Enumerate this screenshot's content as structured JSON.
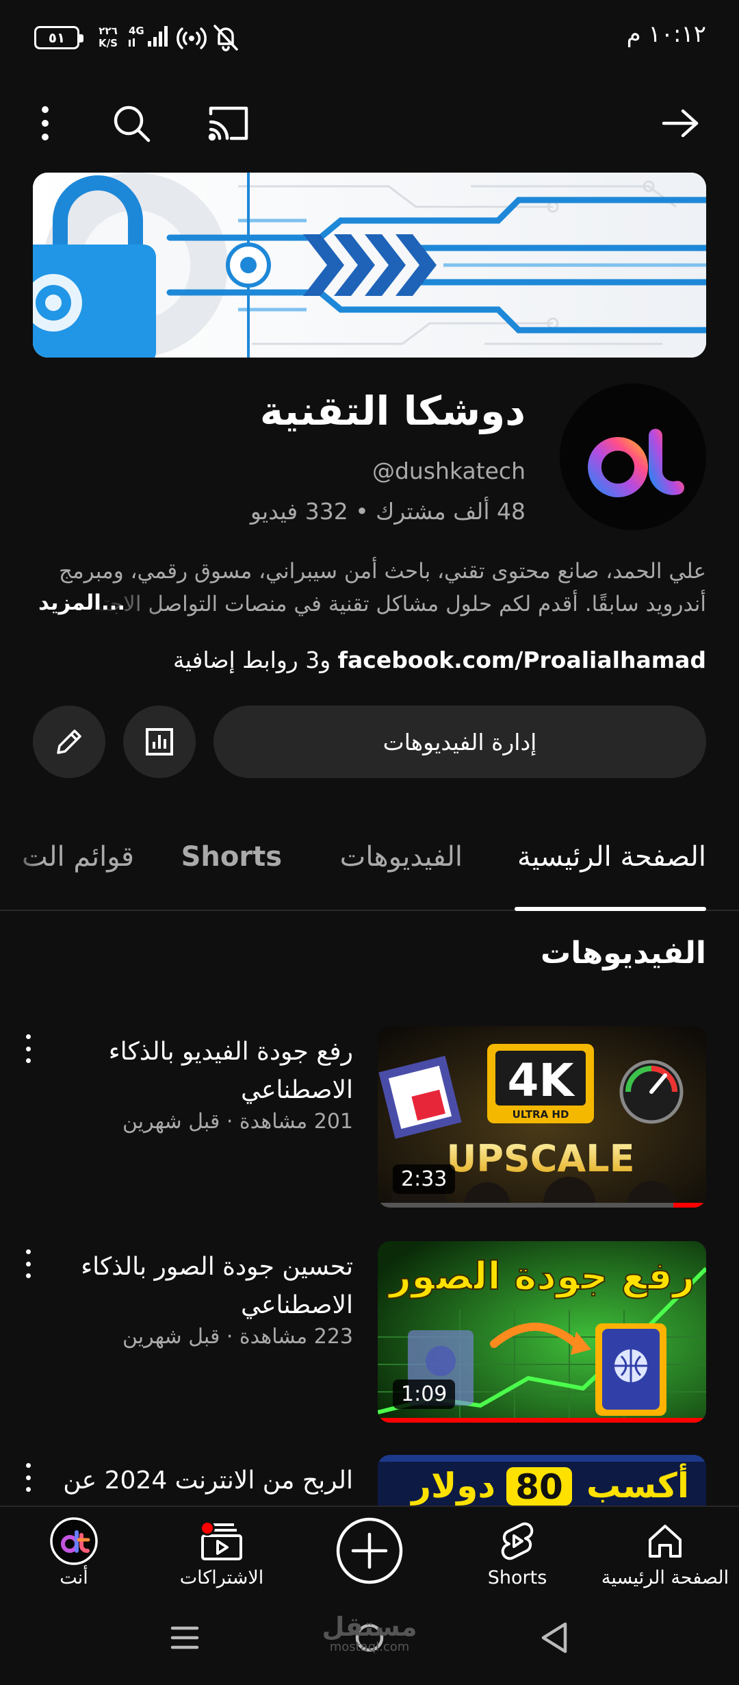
{
  "status_bar": {
    "time": "١٠:١٢ م",
    "battery": "٥١",
    "net_speed_value": "٢٢٦",
    "net_speed_unit": "K/S",
    "network": "4G"
  },
  "app_bar": {
    "icons": [
      "back-arrow-icon",
      "cast-icon",
      "search-icon",
      "more-vert-icon"
    ]
  },
  "channel": {
    "name": "دوشكا التقنية",
    "handle": "@dushkatech",
    "stats": "48 ألف مشترك • 332 فيديو",
    "description_line1": "علي الحمد، صانع محتوى تقني، باحث أمن سيبراني، مسوق رقمي، ومبرمج",
    "description_line2": "أندرويد سابقًا. أقدم لكم حلول مشاكل تقنية في منصات التواصل الاجتماعي",
    "more_label": "...المزيد",
    "link_main": "facebook.com/Proalialhamad",
    "link_extra": "و3 روابط إضافية",
    "manage_button": "إدارة الفيديوهات"
  },
  "tabs": [
    {
      "label": "الصفحة الرئيسية",
      "active": true
    },
    {
      "label": "الفيديوهات",
      "active": false
    },
    {
      "label": "Shorts",
      "active": false
    },
    {
      "label": "قوائم الت",
      "active": false
    }
  ],
  "section_title": "الفيديوهات",
  "videos": [
    {
      "title": "رفع جودة الفيديو بالذكاء الاصطناعي",
      "meta": "201 مشاهدة · قبل شهرين",
      "duration": "2:33",
      "watched": 0.1,
      "thumb_text_main": "4K",
      "thumb_text_sub": "ULTRA HD",
      "thumb_text_bottom": "UPSCALE"
    },
    {
      "title": "تحسين جودة الصور بالذكاء الاصطناعي",
      "meta": "223 مشاهدة · قبل شهرين",
      "duration": "1:09",
      "watched": 1.0,
      "thumb_text_main": "رفع جودة الصور"
    },
    {
      "title": "الربح من الانترنت 2024 عن",
      "thumb_text_a": "أكسب",
      "thumb_text_b": "80",
      "thumb_text_c": "دولار"
    }
  ],
  "bottom_nav": [
    {
      "label": "الصفحة الرئيسية",
      "icon": "home-icon"
    },
    {
      "label": "Shorts",
      "icon": "shorts-icon"
    },
    {
      "label": "",
      "icon": "create-plus-icon"
    },
    {
      "label": "الاشتراكات",
      "icon": "subscriptions-icon"
    },
    {
      "label": "أنت",
      "icon": "avatar"
    }
  ],
  "watermark": {
    "text": "مستقل",
    "sub": "mostaql.com"
  },
  "colors": {
    "background": "#0f0f0f",
    "surface": "#272727",
    "accent_red": "#ff0000",
    "secondary_text": "#aaaaaa"
  }
}
